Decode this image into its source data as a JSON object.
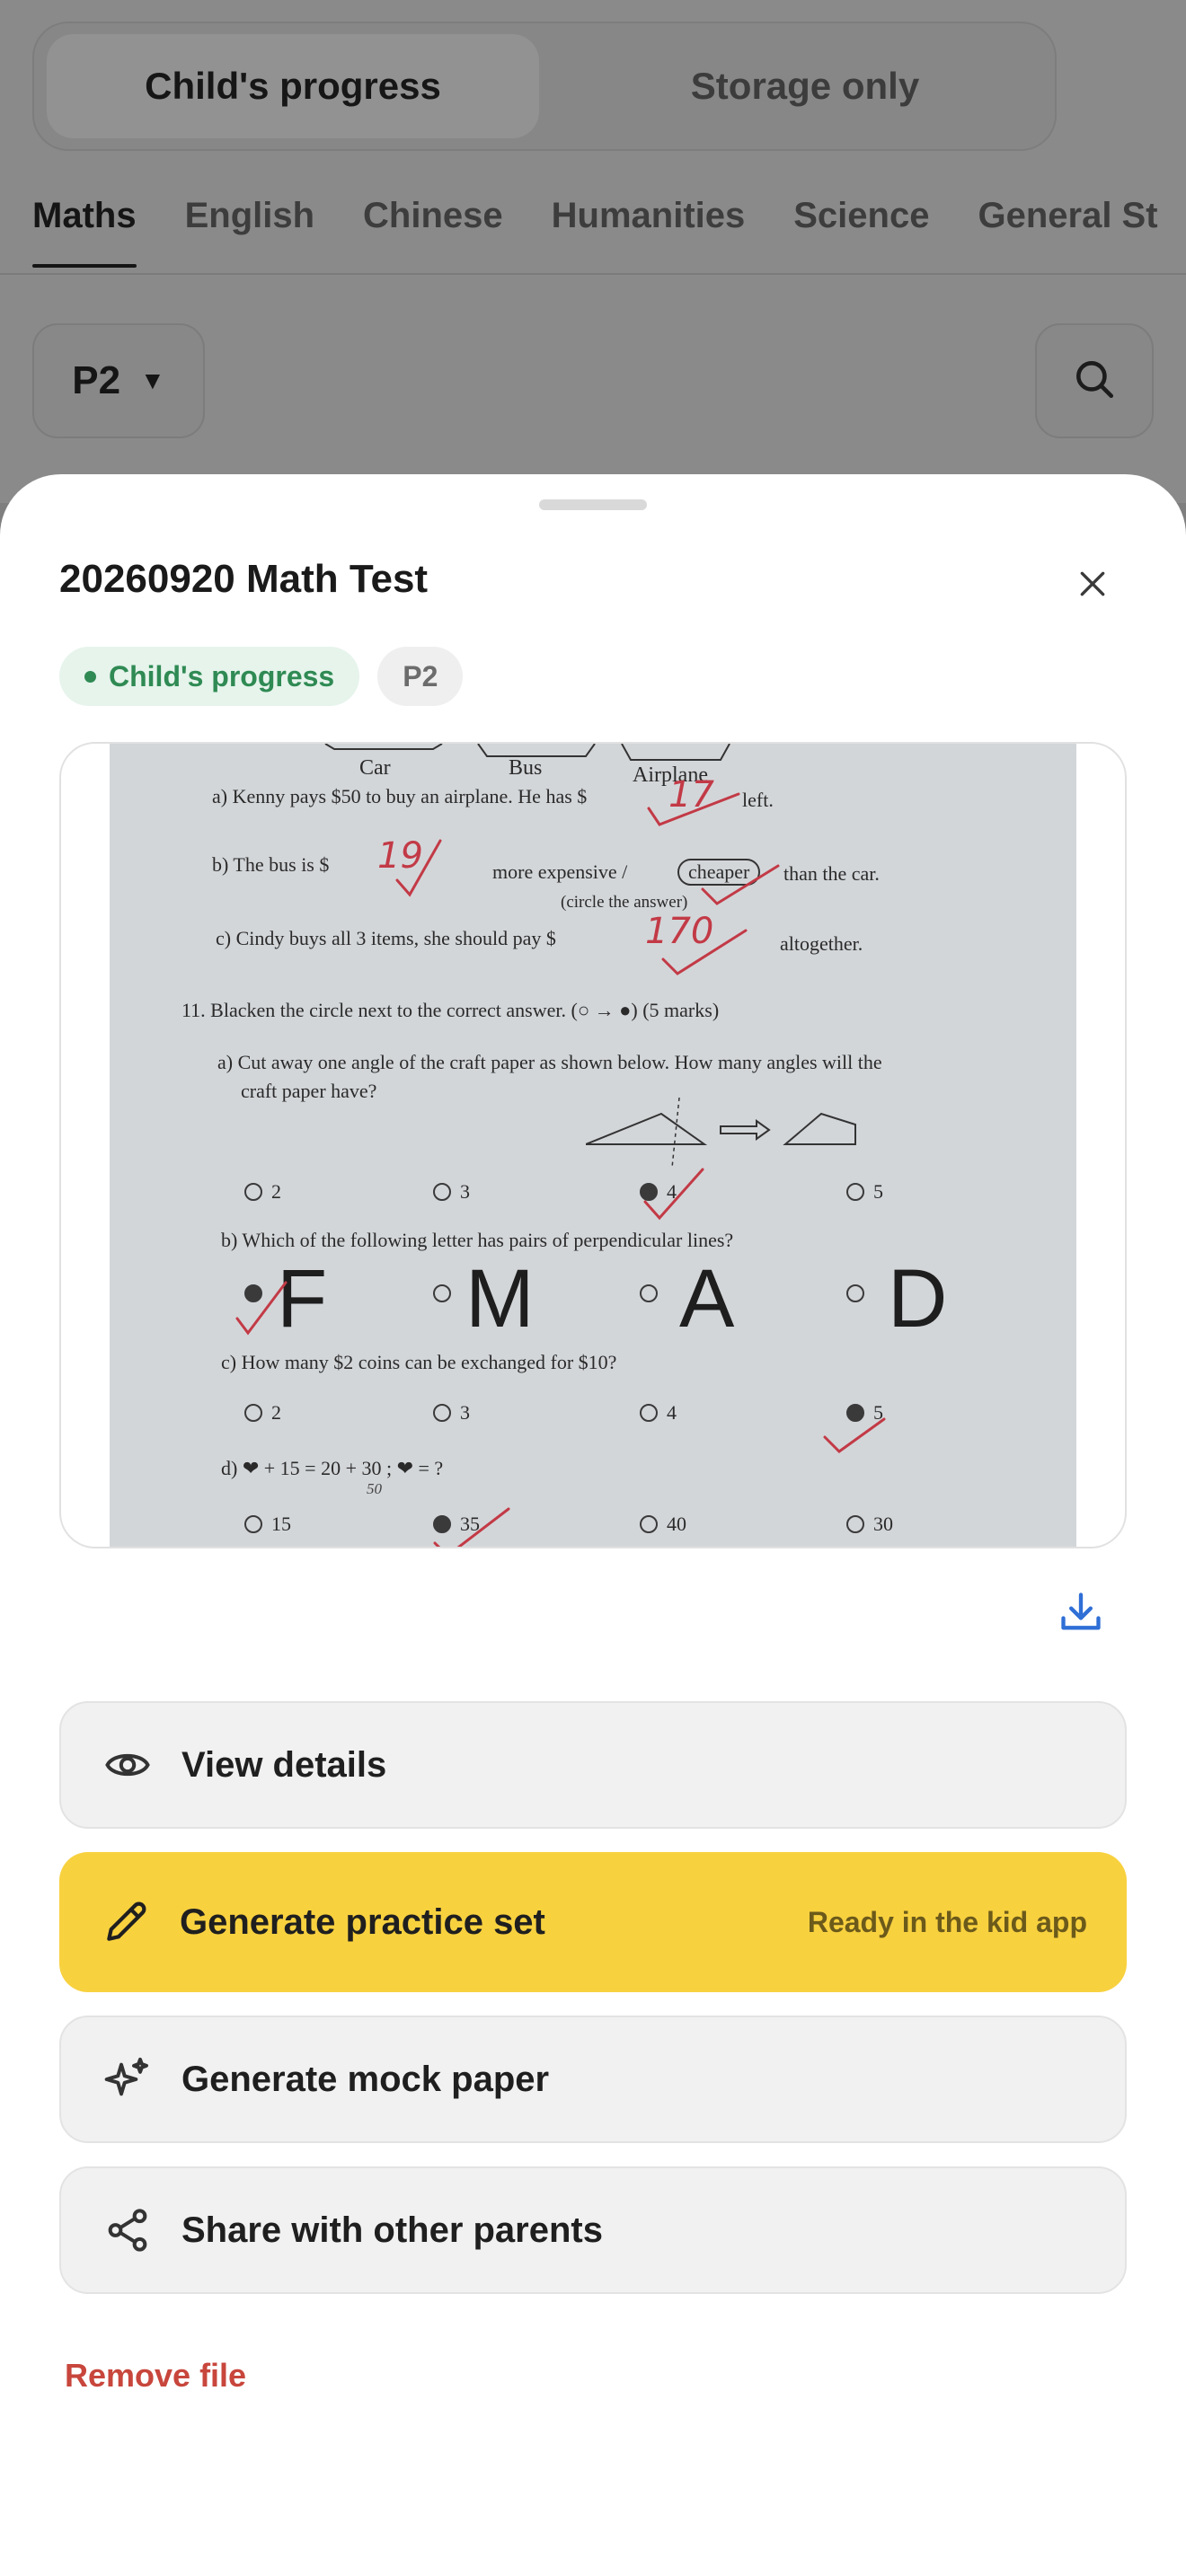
{
  "background": {
    "segment": {
      "active": "Child's progress",
      "inactive": "Storage only"
    },
    "subject_tabs": [
      "Maths",
      "English",
      "Chinese",
      "Humanities",
      "Science",
      "General St"
    ],
    "grade_filter": {
      "value": "P2",
      "caret": "▼"
    }
  },
  "sheet": {
    "title": "20260920 Math Test",
    "badges": {
      "category": "Child's progress",
      "grade": "P2"
    },
    "preview": {
      "lines": {
        "labels_car": "Car",
        "labels_bus": "Bus",
        "labels_airplane": "Airplane",
        "qa": "a)  Kenny pays $50 to buy an airplane. He has $",
        "qa_end": "left.",
        "qb": "b)  The bus is $",
        "qb_mid": "more expensive   /",
        "qb_cheaper": "cheaper",
        "qb_end": "than the car.",
        "qb_note": "(circle the answer)",
        "qc": "c)  Cindy buys all 3 items, she should pay $",
        "qc_end": "altogether.",
        "q11": "11.  Blacken the circle next to the correct answer. (○ → ●) (5 marks)",
        "q11a": "a) Cut away one angle of the craft paper as shown below. How many angles will the",
        "q11a2": "craft paper have?",
        "q11b": "b) Which of the following letter has pairs of perpendicular lines?",
        "q11c": "c) How many $2 coins can be exchanged for $10?",
        "q11d": "d) ❤ + 15 = 20 + 30 ; ❤ = ?",
        "q11d_note": "50"
      },
      "answers": {
        "a": "17",
        "b": "19",
        "c": "170"
      },
      "options_a": [
        "2",
        "3",
        "4",
        "5"
      ],
      "letters": [
        "F",
        "M",
        "A",
        "D"
      ],
      "options_c": [
        "2",
        "3",
        "4",
        "5"
      ],
      "options_d": [
        "15",
        "35",
        "40",
        "30"
      ]
    },
    "actions": {
      "view_details": "View details",
      "generate_practice": "Generate practice set",
      "generate_practice_hint": "Ready in the kid app",
      "generate_mock": "Generate mock paper",
      "share": "Share with other parents"
    },
    "remove_label": "Remove file"
  },
  "colors": {
    "accent_yellow": "#f8d13f",
    "badge_green": "#2f8a53",
    "remove_red": "#c8463c",
    "download_blue": "#2f6fd6"
  },
  "icons": [
    "chevron-down-icon",
    "search-icon",
    "close-icon",
    "download-icon",
    "eye-icon",
    "pencil-icon",
    "sparkle-icon",
    "share-icon"
  ]
}
